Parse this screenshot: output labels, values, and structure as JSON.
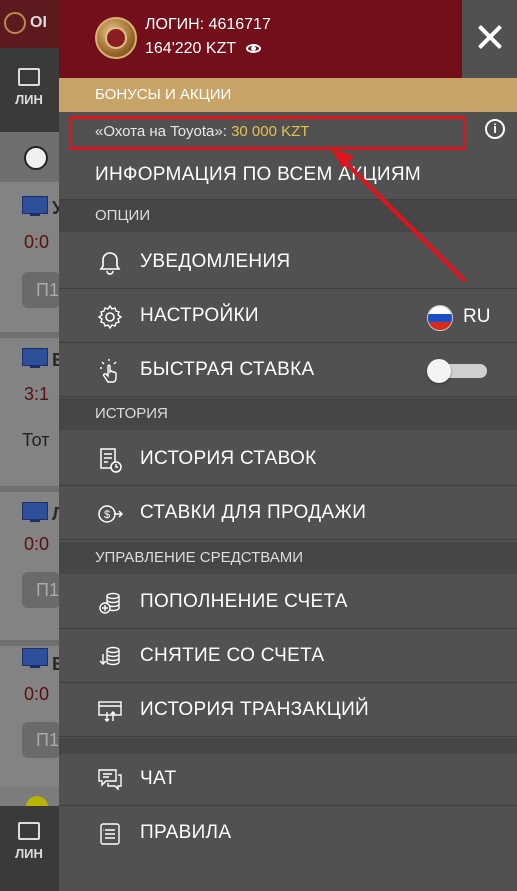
{
  "background": {
    "logo_text": "OI",
    "tab_label": "ЛИН",
    "bottom_tab_label": "ЛИН",
    "scores": [
      "0:0",
      "3:1",
      "0:0",
      "0:0"
    ],
    "letters": [
      "У",
      "Е",
      "Л",
      "Е"
    ],
    "buttons": [
      "П1",
      "П1",
      "П1"
    ],
    "text_partial": "Тот"
  },
  "header": {
    "login_label": "ЛОГИН: 4616717",
    "balance": "164'220 KZT"
  },
  "bonuses": {
    "section_title": "БОНУСЫ И АКЦИИ",
    "promo_prefix": "«Охота на Toyota»: ",
    "promo_amount": "30 000 KZT",
    "all_promos_label": "ИНФОРМАЦИЯ ПО ВСЕМ АКЦИЯМ"
  },
  "options": {
    "section_title": "ОПЦИИ",
    "notifications_label": "УВЕДОМЛЕНИЯ",
    "settings_label": "НАСТРОЙКИ",
    "language": "RU",
    "quick_bet_label": "БЫСТРАЯ СТАВКА",
    "quick_bet_enabled": false
  },
  "history": {
    "section_title": "ИСТОРИЯ",
    "bet_history_label": "ИСТОРИЯ СТАВОК",
    "bets_for_sale_label": "СТАВКИ ДЛЯ ПРОДАЖИ"
  },
  "funds": {
    "section_title": "УПРАВЛЕНИЕ СРЕДСТВАМИ",
    "deposit_label": "ПОПОЛНЕНИЕ СЧЕТА",
    "withdraw_label": "СНЯТИЕ СО СЧЕТА",
    "transactions_label": "ИСТОРИЯ ТРАНЗАКЦИЙ"
  },
  "support": {
    "chat_label": "ЧАТ",
    "rules_label": "ПРАВИЛА"
  },
  "colors": {
    "header_red": "#730e1b",
    "gold": "#c9a468",
    "promo_amount": "#e8c14a",
    "annotation_red": "#e0141c"
  }
}
